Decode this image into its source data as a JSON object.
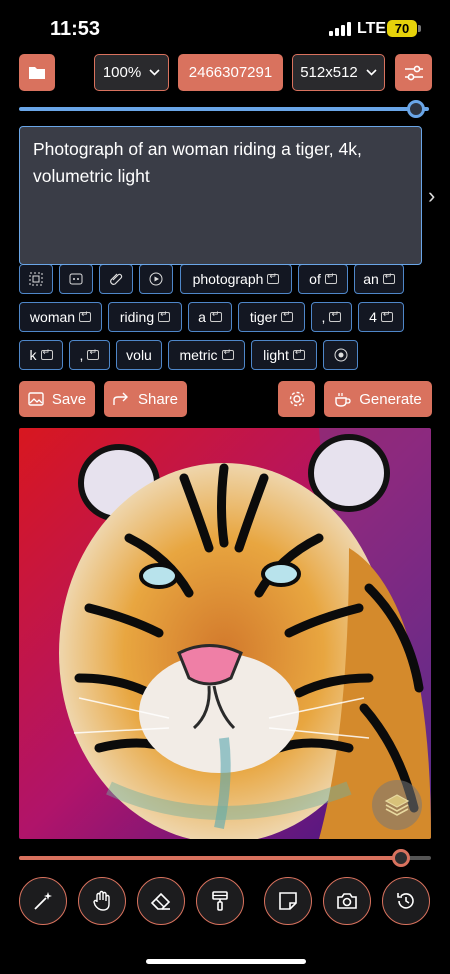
{
  "status": {
    "time": "11:53",
    "network": "LTE",
    "battery": "70"
  },
  "toolbar": {
    "folder_icon": "folder-icon",
    "zoom": "100%",
    "seed": "2466307291",
    "size": "512x512",
    "settings_icon": "sliders-icon"
  },
  "sliders": {
    "top_value": 1.0,
    "bottom_value": 0.93
  },
  "prompt": {
    "text": "Photograph of an woman riding a tiger, 4k, volumetric light"
  },
  "tags": {
    "row1": [
      "photograph",
      "of",
      "an"
    ],
    "row2": [
      "woman",
      "riding",
      "a",
      "tiger",
      ",",
      "4"
    ],
    "row3": [
      "k",
      ",",
      "volu",
      "metric",
      "light"
    ]
  },
  "actions": {
    "save": "Save",
    "share": "Share",
    "generate": "Generate"
  },
  "colors": {
    "accent": "#d9725e",
    "field_border": "#6aa6e8",
    "tag_border": "#4f87c9"
  }
}
